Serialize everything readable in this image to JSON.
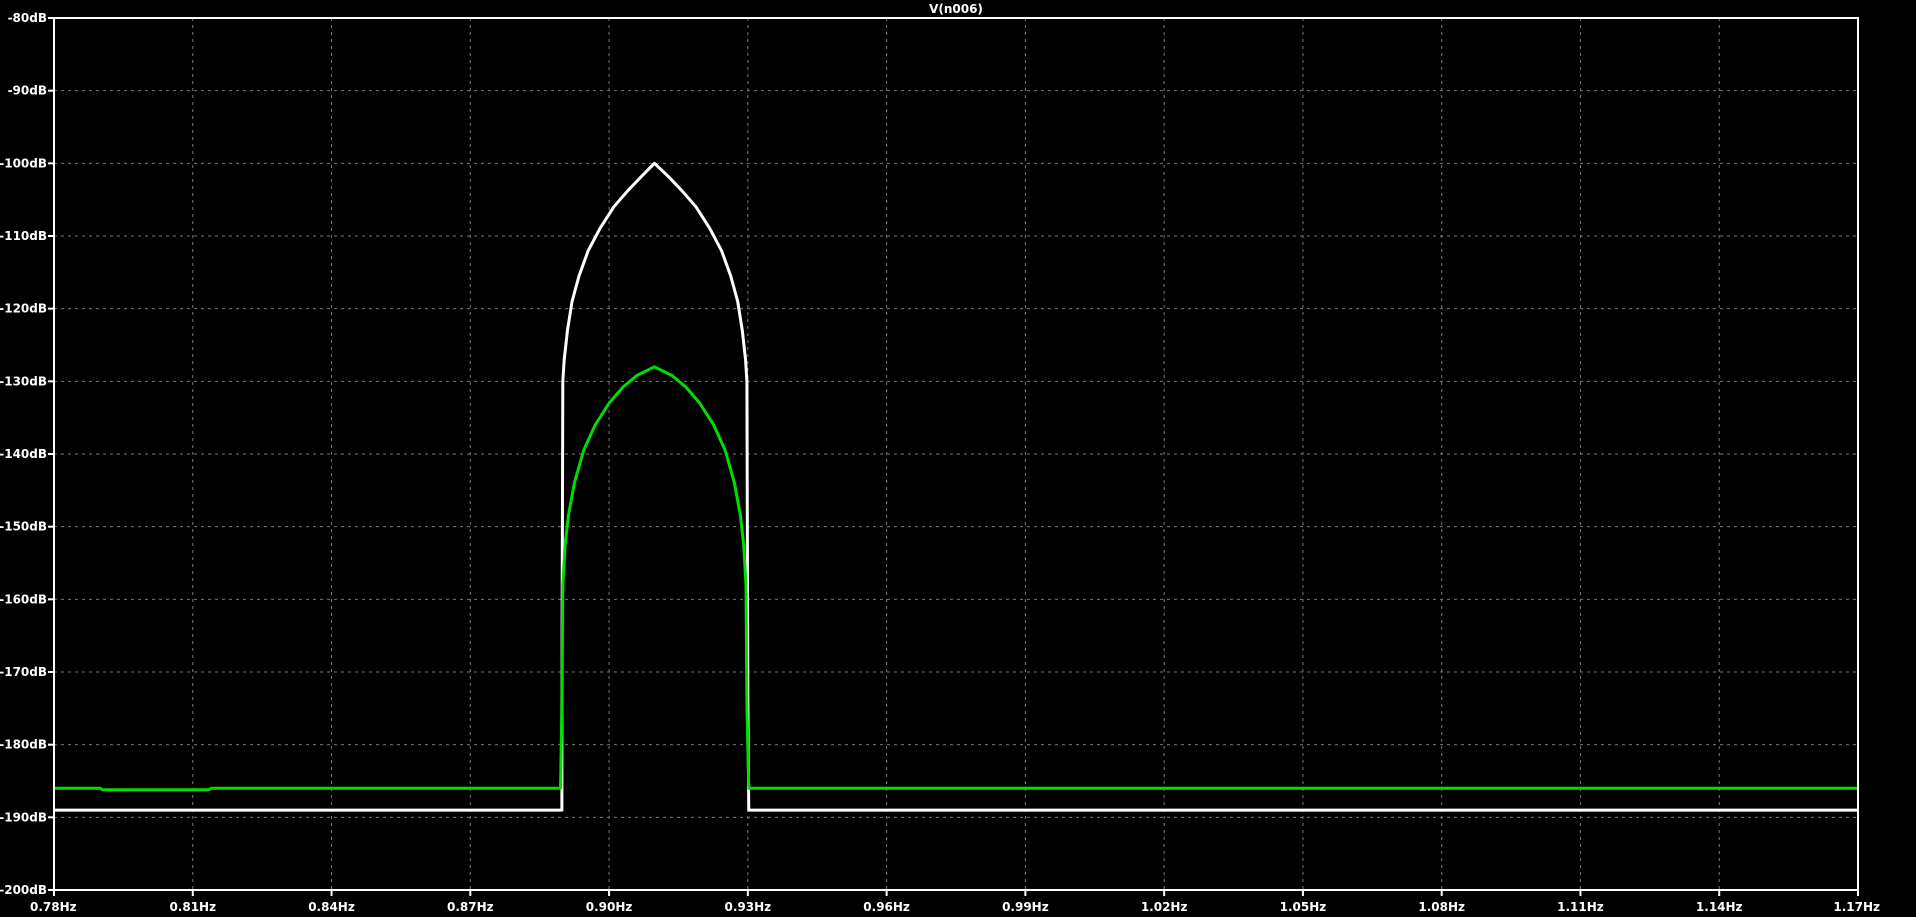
{
  "chart_data": {
    "type": "line",
    "title": "V(n006)",
    "xlabel": "",
    "ylabel": "",
    "xlim": [
      0.78,
      1.17
    ],
    "ylim": [
      -200,
      -80
    ],
    "grid": true,
    "background": "#000000",
    "x_ticks": [
      "0.78Hz",
      "0.81Hz",
      "0.84Hz",
      "0.87Hz",
      "0.90Hz",
      "0.93Hz",
      "0.96Hz",
      "0.99Hz",
      "1.02Hz",
      "1.05Hz",
      "1.08Hz",
      "1.11Hz",
      "1.14Hz",
      "1.17Hz"
    ],
    "x_tick_values": [
      0.78,
      0.81,
      0.84,
      0.87,
      0.9,
      0.93,
      0.96,
      0.99,
      1.02,
      1.05,
      1.08,
      1.11,
      1.14,
      1.17
    ],
    "y_ticks": [
      "-80dB",
      "-90dB",
      "-100dB",
      "-110dB",
      "-120dB",
      "-130dB",
      "-140dB",
      "-150dB",
      "-160dB",
      "-170dB",
      "-180dB",
      "-190dB",
      "-200dB"
    ],
    "y_tick_values": [
      -80,
      -90,
      -100,
      -110,
      -120,
      -130,
      -140,
      -150,
      -160,
      -170,
      -180,
      -190,
      -200
    ],
    "series": [
      {
        "color": "#ffffff",
        "points": [
          [
            0.78,
            -189.0
          ],
          [
            0.8898,
            -189.0
          ],
          [
            0.8898,
            -174.0
          ],
          [
            0.89,
            -130.0
          ],
          [
            0.8903,
            -127.0
          ],
          [
            0.891,
            -123.0
          ],
          [
            0.892,
            -119.0
          ],
          [
            0.8935,
            -115.5
          ],
          [
            0.8955,
            -112.0
          ],
          [
            0.898,
            -109.0
          ],
          [
            0.901,
            -106.0
          ],
          [
            0.904,
            -103.8
          ],
          [
            0.907,
            -101.8
          ],
          [
            0.9098,
            -100.0
          ],
          [
            0.9128,
            -101.8
          ],
          [
            0.9158,
            -103.8
          ],
          [
            0.9188,
            -106.0
          ],
          [
            0.9218,
            -109.0
          ],
          [
            0.9243,
            -112.0
          ],
          [
            0.9263,
            -115.5
          ],
          [
            0.9278,
            -119.0
          ],
          [
            0.9288,
            -123.0
          ],
          [
            0.9295,
            -127.0
          ],
          [
            0.9298,
            -130.0
          ],
          [
            0.93,
            -174.0
          ],
          [
            0.9302,
            -189.0
          ],
          [
            1.17,
            -189.0
          ]
        ]
      },
      {
        "color": "#00dd00",
        "points": [
          [
            0.78,
            -186.0
          ],
          [
            0.79,
            -186.0
          ],
          [
            0.7905,
            -186.2
          ],
          [
            0.8135,
            -186.2
          ],
          [
            0.814,
            -186.0
          ],
          [
            0.8895,
            -186.0
          ],
          [
            0.8898,
            -175.0
          ],
          [
            0.89,
            -158.0
          ],
          [
            0.8905,
            -152.5
          ],
          [
            0.8912,
            -148.5
          ],
          [
            0.8925,
            -144.0
          ],
          [
            0.8945,
            -139.5
          ],
          [
            0.897,
            -136.0
          ],
          [
            0.9,
            -133.0
          ],
          [
            0.903,
            -130.8
          ],
          [
            0.906,
            -129.2
          ],
          [
            0.9098,
            -128.0
          ],
          [
            0.9136,
            -129.2
          ],
          [
            0.9166,
            -130.8
          ],
          [
            0.9196,
            -133.0
          ],
          [
            0.9226,
            -136.0
          ],
          [
            0.9251,
            -139.5
          ],
          [
            0.9271,
            -144.0
          ],
          [
            0.9284,
            -148.5
          ],
          [
            0.9291,
            -152.5
          ],
          [
            0.9296,
            -158.0
          ],
          [
            0.9298,
            -175.0
          ],
          [
            0.9302,
            -186.0
          ],
          [
            1.17,
            -186.0
          ]
        ]
      }
    ]
  }
}
